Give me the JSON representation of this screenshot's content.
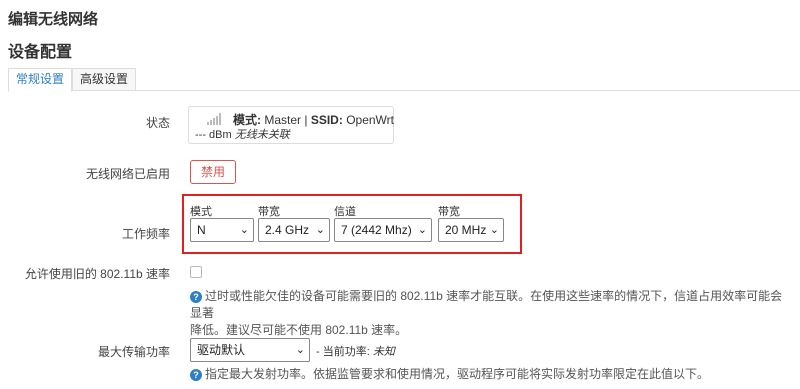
{
  "window_title": "编辑无线网络",
  "section_title": "设备配置",
  "tabs": [
    {
      "label": "常规设置",
      "active": true
    },
    {
      "label": "高级设置",
      "active": false
    }
  ],
  "status": {
    "label": "状态",
    "mode_key": "模式:",
    "mode_value": "Master",
    "separator": "|",
    "ssid_key": "SSID:",
    "ssid_value": "OpenWrt",
    "signal": "--- dBm",
    "association": "无线未关联"
  },
  "wireless_enabled": {
    "label": "无线网络已启用",
    "button": "禁用"
  },
  "frequency": {
    "label": "工作频率",
    "mode_label": "模式",
    "mode_value": "N",
    "band_label": "带宽",
    "band_value": "2.4 GHz",
    "channel_label": "信道",
    "channel_value": "7 (2442 Mhz)",
    "width_label": "带宽",
    "width_value": "20 MHz"
  },
  "legacy_rates": {
    "label": "允许使用旧的 802.11b 速率",
    "checked": false,
    "help_line1": "过时或性能欠佳的设备可能需要旧的 802.11b 速率才能互联。在使用这些速率的情况下，信道占用效率可能会显著",
    "help_line2": "降低。建议尽可能不使用 802.11b 速率。"
  },
  "tx_power": {
    "label": "最大传输功率",
    "value": "驱动默认",
    "current_prefix": "- 当前功率:",
    "current_value": "未知",
    "help": "指定最大发射功率。依据监管要求和使用情况，驱动程序可能将实际发射功率限定在此值以下。"
  },
  "colors": {
    "accent": "#2f7fc6",
    "danger": "#d9534f",
    "highlight": "#e31e1e"
  }
}
